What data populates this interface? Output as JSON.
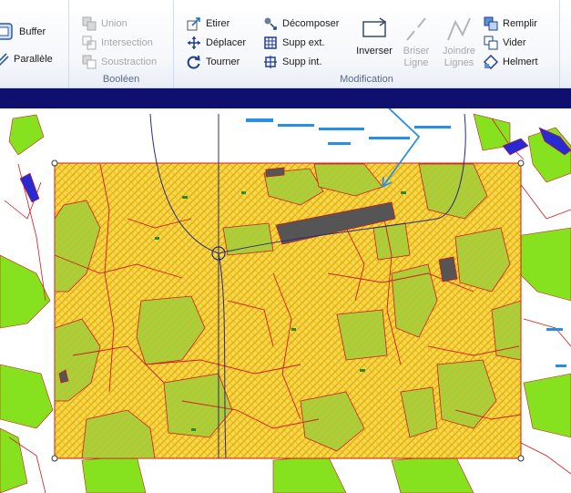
{
  "ribbon": {
    "left_tools": {
      "buffer": "Buffer",
      "parallel": "Parallèle"
    },
    "boolean": {
      "title": "Booléen",
      "union": "Union",
      "intersection": "Intersection",
      "subtraction": "Soustraction"
    },
    "modification": {
      "title": "Modification",
      "stretch": "Etirer",
      "move": "Déplacer",
      "rotate": "Tourner",
      "decompose": "Décomposer",
      "delete_ext": "Supp ext.",
      "delete_int": "Supp int.",
      "invert": "Inverser",
      "break_line_1": "Briser",
      "break_line_2": "Ligne",
      "join_lines_1": "Joindre",
      "join_lines_2": "Lignes",
      "fill": "Remplir",
      "empty": "Vider",
      "helmert": "Helmert"
    }
  },
  "colors": {
    "polygon_fill": "#f5d84a",
    "polygon_hatch": "#e0a800",
    "polygon_border": "#d11a1a",
    "vegetation": "#86e21e",
    "building": "#555555",
    "annotation_arrow": "#2a8fe0",
    "title_strip": "#0f0f6e"
  }
}
